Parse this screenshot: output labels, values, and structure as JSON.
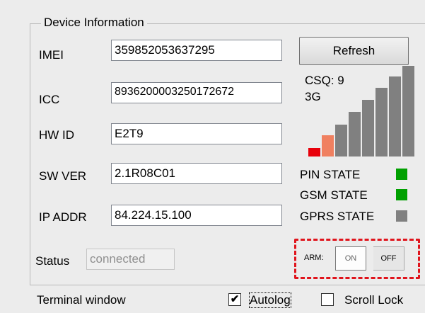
{
  "group": {
    "title": "Device Information"
  },
  "fields": {
    "imei": {
      "label": "IMEI",
      "value": "359852053637295"
    },
    "icc": {
      "label": "ICC",
      "value": "8936200003250172672"
    },
    "hwid": {
      "label": "HW ID",
      "value": "E2T9"
    },
    "swver": {
      "label": "SW VER",
      "value": "2.1R08C01"
    },
    "ipaddr": {
      "label": "IP ADDR",
      "value": "84.224.15.100"
    },
    "status": {
      "label": "Status",
      "value": "connected"
    }
  },
  "refresh_label": "Refresh",
  "signal": {
    "csq": "CSQ: 9",
    "network": "3G",
    "bars_total": 8,
    "bar_colors": [
      "#e8000b",
      "#f08060",
      "#808080",
      "#808080",
      "#808080",
      "#808080",
      "#808080",
      "#808080"
    ]
  },
  "states": [
    {
      "label": "PIN STATE",
      "color": "#00a000"
    },
    {
      "label": "GSM STATE",
      "color": "#00a000"
    },
    {
      "label": "GPRS STATE",
      "color": "#808080"
    }
  ],
  "arm": {
    "label": "ARM:",
    "on": "ON",
    "off": "OFF",
    "selected": "ON"
  },
  "bottom": {
    "terminal_label": "Terminal window",
    "autolog": {
      "label": "Autolog",
      "checked": true
    },
    "scroll_lock": {
      "label": "Scroll Lock",
      "checked": false
    }
  },
  "colors": {
    "highlight": "#e0141c"
  }
}
